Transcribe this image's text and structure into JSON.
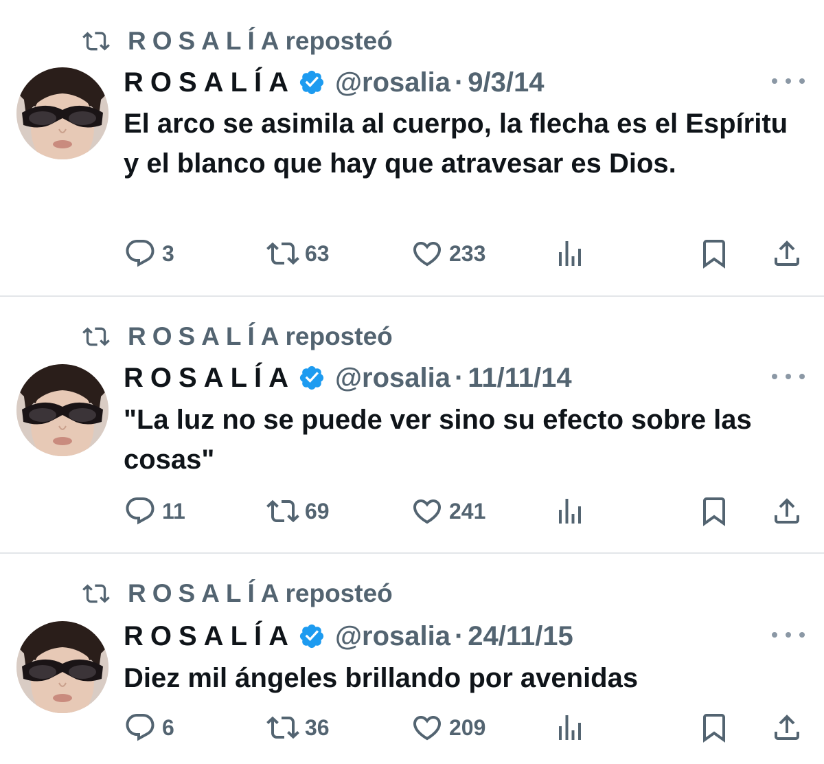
{
  "repost_label": {
    "name": "ROSALÍA",
    "verb": "reposteó"
  },
  "author": {
    "name": "ROSALÍA",
    "handle": "@rosalia",
    "separator": "·"
  },
  "tweets": [
    {
      "date": "9/3/14",
      "text": "El arco se asimila al cuerpo, la flecha es el Espíritu y el blanco que hay que atravesar es Dios.",
      "replies": "3",
      "reposts": "63",
      "likes": "233"
    },
    {
      "date": "11/11/14",
      "text": "\"La luz no se puede ver sino su efecto sobre las cosas\"",
      "replies": "11",
      "reposts": "69",
      "likes": "241"
    },
    {
      "date": "24/11/15",
      "text": "Diez mil ángeles brillando por avenidas",
      "replies": "6",
      "reposts": "36",
      "likes": "209"
    }
  ],
  "icons": {
    "repost": "repost-icon",
    "verified": "verified-badge-icon",
    "more": "more-icon",
    "reply": "reply-icon",
    "like": "heart-icon",
    "views": "views-icon",
    "bookmark": "bookmark-icon",
    "share": "share-icon"
  },
  "colors": {
    "secondary_text": "#536471",
    "verified": "#1d9bf0",
    "divider": "#e3e6e9"
  }
}
